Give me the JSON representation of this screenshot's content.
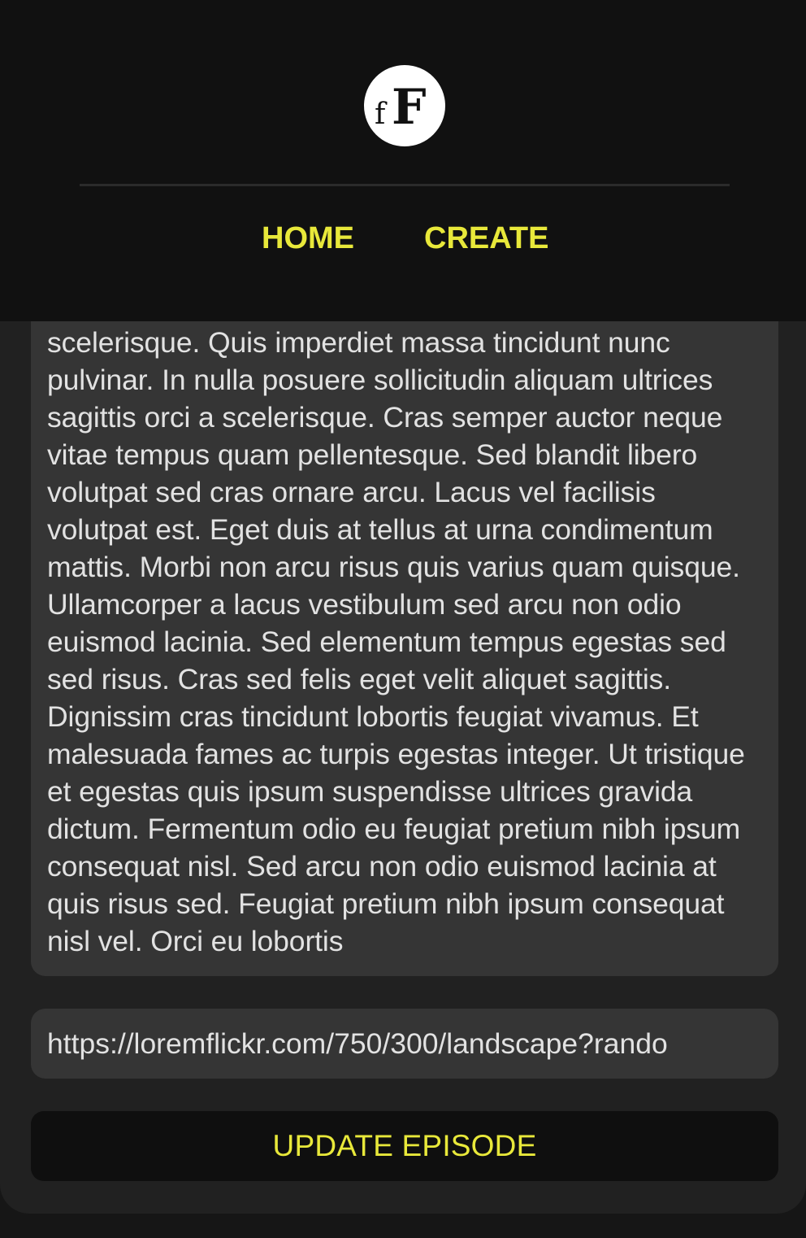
{
  "header": {
    "logo_text": "fF",
    "nav": {
      "home_label": "HOME",
      "create_label": "CREATE"
    }
  },
  "form": {
    "description_value": "Lorem ipsum dolor sit amet consectetur adipiscing elit. Faucibus in ornare quam viverra orci sagittis eu volutpat odio. Tristique senectus et netus et malesuada fames. Eget egestas purus viverra accumsan in nisl nisi scelerisque. Quis imperdiet massa tincidunt nunc pulvinar. In nulla posuere sollicitudin aliquam ultrices sagittis orci a scelerisque. Cras semper auctor neque vitae tempus quam pellentesque. Sed blandit libero volutpat sed cras ornare arcu. Lacus vel facilisis volutpat est. Eget duis at tellus at urna condimentum mattis. Morbi non arcu risus quis varius quam quisque. Ullamcorper a lacus vestibulum sed arcu non odio euismod lacinia. Sed elementum tempus egestas sed sed risus. Cras sed felis eget velit aliquet sagittis. Dignissim cras tincidunt lobortis feugiat vivamus. Et malesuada fames ac turpis egestas integer. Ut tristique et egestas quis ipsum suspendisse ultrices gravida dictum. Fermentum odio eu feugiat pretium nibh ipsum consequat nisl. Sed arcu non odio euismod lacinia at quis risus sed. Feugiat pretium nibh ipsum consequat nisl vel. Orci eu lobortis",
    "image_url_value": "https://loremflickr.com/750/300/landscape?rando",
    "submit_label": "UPDATE EPISODE"
  },
  "colors": {
    "accent": "#e8e83a",
    "header_bg": "#111111",
    "card_bg": "#212121",
    "field_bg": "#353535",
    "text": "#e2e2e2"
  },
  "icons": {
    "logo": "fF-logo-icon"
  }
}
